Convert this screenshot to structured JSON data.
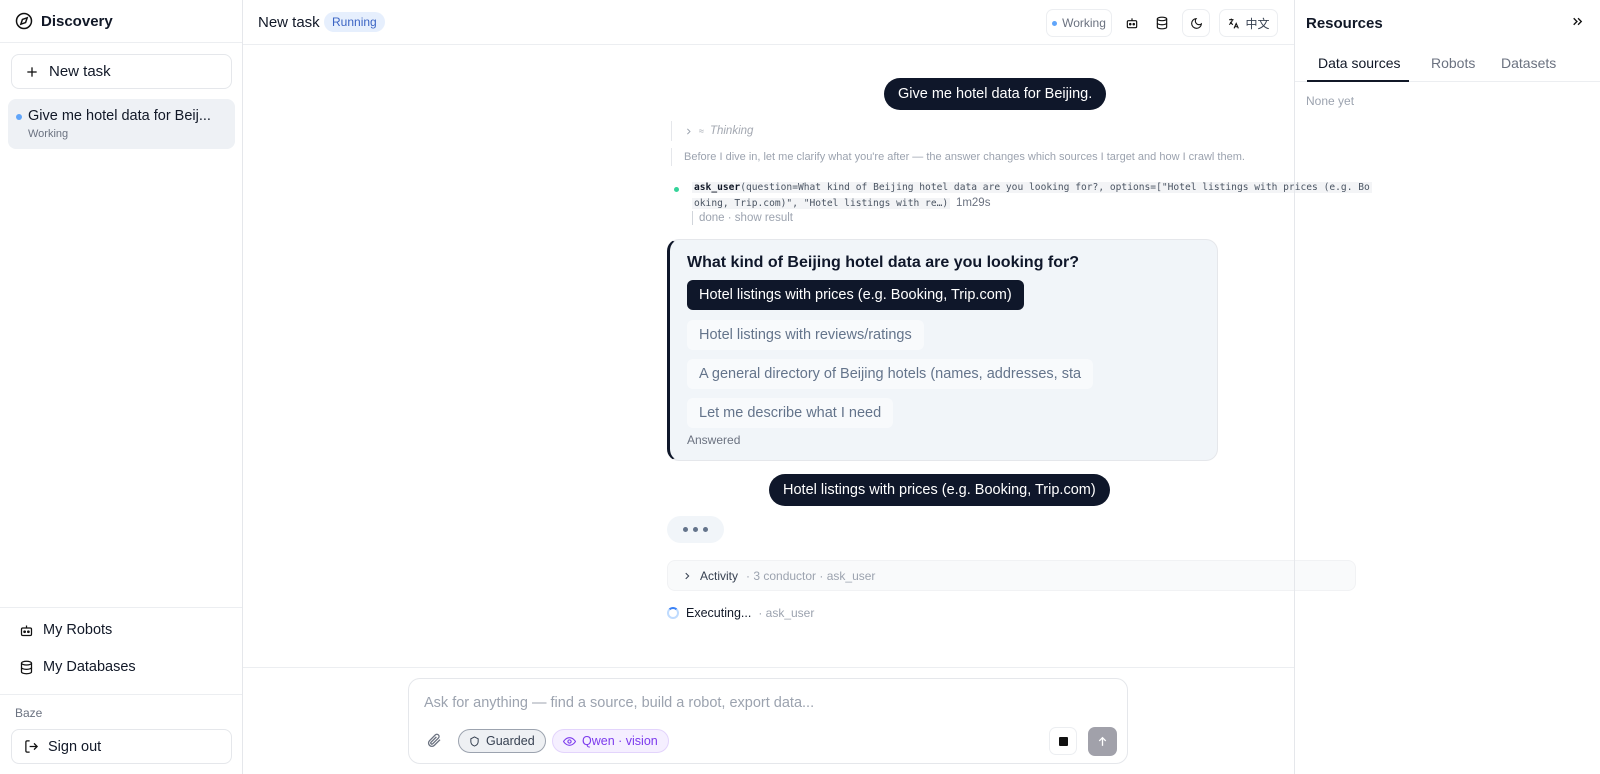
{
  "sidebar": {
    "brand": "Discovery",
    "new_task": "New task",
    "tasks": [
      {
        "title": "Give me hotel data for Beij...",
        "status": "Working"
      }
    ],
    "my_robots": "My Robots",
    "my_databases": "My Databases",
    "org": "Baze",
    "sign_out": "Sign out"
  },
  "topbar": {
    "title": "New task",
    "badge": "Running",
    "status": "Working",
    "lang": "中文"
  },
  "chat": {
    "user_message_1": "Give me hotel data for Beijing.",
    "thinking": "Thinking",
    "pretext": "Before I dive in, let me clarify what you're after — the answer changes which sources I target and how I crawl them.",
    "tool_name": "ask_user",
    "tool_args_1": "(question=What kind of Beijing hotel data are you looking for?, options=[\"Hotel listings with prices (e.g. Bo",
    "tool_args_2": "oking, Trip.com)\", \"Hotel listings with re…)",
    "tool_duration": "1m29s",
    "tool_done": "done · show result",
    "question": {
      "title": "What kind of Beijing hotel data are you looking for?",
      "options": [
        "Hotel listings with prices (e.g. Booking, Trip.com)",
        "Hotel listings with reviews/ratings",
        "A general directory of Beijing hotels (names, addresses, sta",
        "Let me describe what I need"
      ],
      "selected_index": 0,
      "answered": "Answered"
    },
    "user_message_2": "Hotel listings with prices (e.g. Booking, Trip.com)",
    "activity_label": "Activity",
    "activity_meta": "· 3   conductor · ask_user",
    "executing_label": "Executing...",
    "executing_meta": "· ask_user"
  },
  "composer": {
    "placeholder": "Ask for anything — find a source, build a robot, export data...",
    "guard_chip": "Guarded",
    "model_chip": "Qwen · vision"
  },
  "resources": {
    "title": "Resources",
    "tabs": [
      "Data sources",
      "Robots",
      "Datasets"
    ],
    "active_tab": 0,
    "empty": "None yet"
  },
  "icons": {
    "brand": "compass-icon",
    "plus": "plus-icon",
    "robot": "robot-icon",
    "database": "database-icon",
    "signout": "sign-out-icon",
    "theme": "moon-icon",
    "translate": "translate-icon",
    "attach": "paperclip-icon",
    "shield": "shield-icon",
    "eye": "eye-icon",
    "stop": "stop-icon",
    "send": "arrow-up-icon",
    "collapse": "double-chevron-right-icon"
  },
  "colors": {
    "accent_dark": "#0f172a",
    "running_badge_bg": "#e6effd",
    "running_badge_text": "#3b64c4",
    "status_dot": "#60a5fa",
    "tool_dot": "#34d399",
    "model_chip": "#7c3aed"
  }
}
